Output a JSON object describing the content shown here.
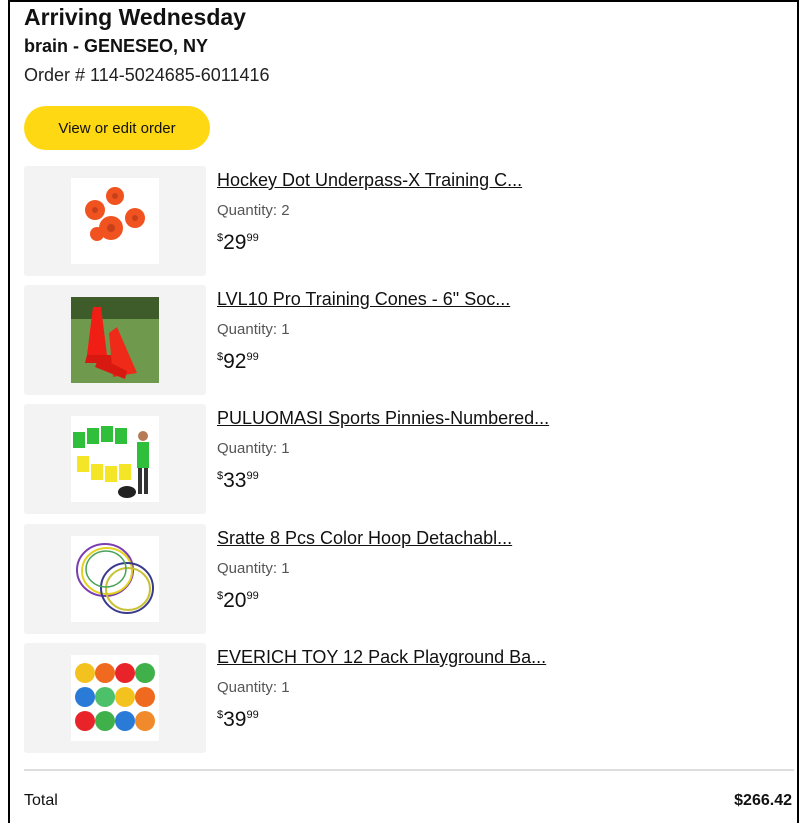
{
  "shipment": {
    "arriving": "Arriving Wednesday",
    "ship_to": "brain - GENESEO, NY",
    "order_number": "Order # 114-5024685-6011416",
    "view_edit_label": "View or edit order"
  },
  "items": [
    {
      "title": "Hockey Dot Underpass-X Training C...",
      "quantity": "Quantity: 2",
      "price_symbol": "$",
      "price_whole": "29",
      "price_fraction": "99",
      "image_icon": "orange-cone-dots-icon"
    },
    {
      "title": "LVL10 Pro Training Cones - 6\" Soc...",
      "quantity": "Quantity: 1",
      "price_symbol": "$",
      "price_whole": "92",
      "price_fraction": "99",
      "image_icon": "training-cones-icon"
    },
    {
      "title": "PULUOMASI Sports Pinnies-Numbered...",
      "quantity": "Quantity: 1",
      "price_symbol": "$",
      "price_whole": "33",
      "price_fraction": "99",
      "image_icon": "sports-pinnies-icon"
    },
    {
      "title": "Sratte 8 Pcs Color Hoop Detachabl...",
      "quantity": "Quantity: 1",
      "price_symbol": "$",
      "price_whole": "20",
      "price_fraction": "99",
      "image_icon": "color-hoops-icon"
    },
    {
      "title": "EVERICH TOY 12 Pack Playground Ba...",
      "quantity": "Quantity: 1",
      "price_symbol": "$",
      "price_whole": "39",
      "price_fraction": "99",
      "image_icon": "playground-balls-icon"
    }
  ],
  "summary": {
    "total_label": "Total",
    "total_value": "$266.42"
  },
  "colors": {
    "button_yellow": "#ffd814",
    "thumb_background": "#f3f3f3",
    "cone_orange": "#f0531f",
    "pinnie_green": "#2fbf3a",
    "pinnie_yellow": "#f4e626"
  }
}
